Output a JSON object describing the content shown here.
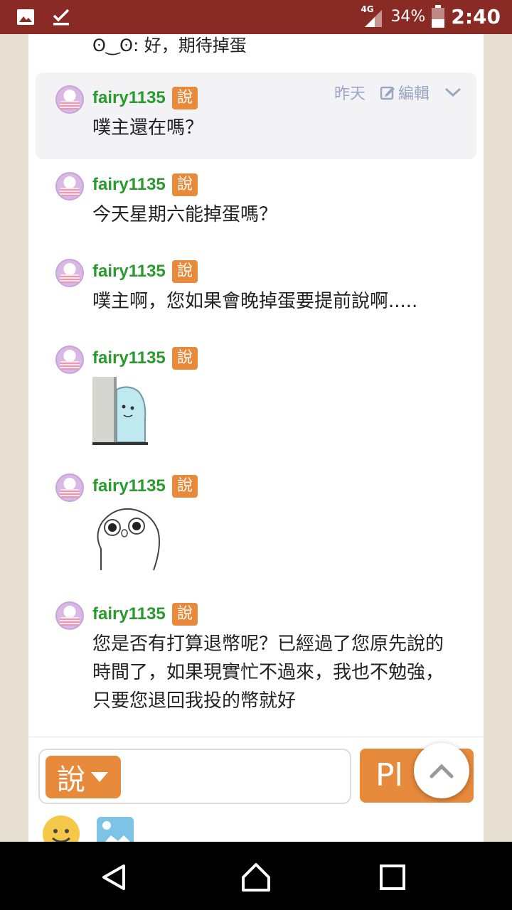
{
  "statusbar": {
    "network": "4G",
    "battery": "34%",
    "time": "2:40",
    "icons": [
      "image-icon",
      "download-done-icon",
      "signal-icon",
      "battery-icon"
    ]
  },
  "top_partial": "ʘ‿ʘ: 好，期待掉蛋",
  "responses": [
    {
      "user": "fairy1135",
      "qualifier": "說",
      "text": "噗主還在嗎？",
      "time": "昨天",
      "edit": "編輯"
    },
    {
      "user": "fairy1135",
      "qualifier": "說",
      "text": "今天星期六能掉蛋嗎？"
    },
    {
      "user": "fairy1135",
      "qualifier": "說",
      "text": "噗主啊，您如果會晚掉蛋要提前說啊....."
    },
    {
      "user": "fairy1135",
      "qualifier": "說",
      "sticker": "peeking-dinosaur-sticker"
    },
    {
      "user": "fairy1135",
      "qualifier": "說",
      "sticker": "surprised-blob-sticker"
    },
    {
      "user": "fairy1135",
      "qualifier": "說",
      "text": "您是否有打算退幣呢？已經過了您原先說的時間了，如果現實忙不過來，我也不勉強，只要您退回我投的幣就好"
    }
  ],
  "input": {
    "qualifier": "說",
    "plurk_button": "Pl"
  },
  "colors": {
    "statusbar": "#8a2a24",
    "username": "#2a9a2f",
    "qualifier": "#e88a3c",
    "meta": "#9aa5c0"
  }
}
